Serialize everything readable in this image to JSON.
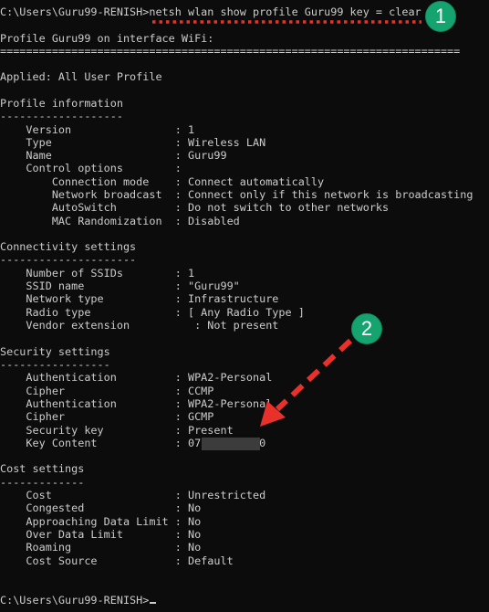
{
  "terminal": {
    "command_line": "C:\\Users\\Guru99-RENISH>netsh wlan show profile Guru99 key = clear",
    "lines": [
      "Profile Guru99 on interface WiFi:",
      "=======================================================================",
      "Applied: All User Profile",
      "Profile information",
      "-------------------",
      "    Version                : 1",
      "    Type                   : Wireless LAN",
      "    Name                   : Guru99",
      "    Control options        :",
      "        Connection mode    : Connect automatically",
      "        Network broadcast  : Connect only if this network is broadcasting",
      "        AutoSwitch         : Do not switch to other networks",
      "        MAC Randomization  : Disabled",
      "Connectivity settings",
      "---------------------",
      "    Number of SSIDs        : 1",
      "    SSID name              : \"Guru99\"",
      "    Network type           : Infrastructure",
      "    Radio type             : [ Any Radio Type ]",
      "    Vendor extension          : Not present",
      "Security settings",
      "-----------------",
      "    Authentication         : WPA2-Personal",
      "    Cipher                 : CCMP",
      "    Authentication         : WPA2-Personal",
      "    Cipher                 : GCMP",
      "    Security key           : Present",
      "    Key Content            : 07         0",
      "Cost settings",
      "-------------",
      "    Cost                   : Unrestricted",
      "    Congested              : No",
      "    Approaching Data Limit : No",
      "    Over Data Limit        : No",
      "    Roaming                : No",
      "    Cost Source            : Default"
    ],
    "prompt": "C:\\Users\\Guru99-RENISH>"
  },
  "annotations": {
    "badge_1": "1",
    "badge_2": "2",
    "accent_color": "#e8312a",
    "badge_color": "#15a36f"
  }
}
